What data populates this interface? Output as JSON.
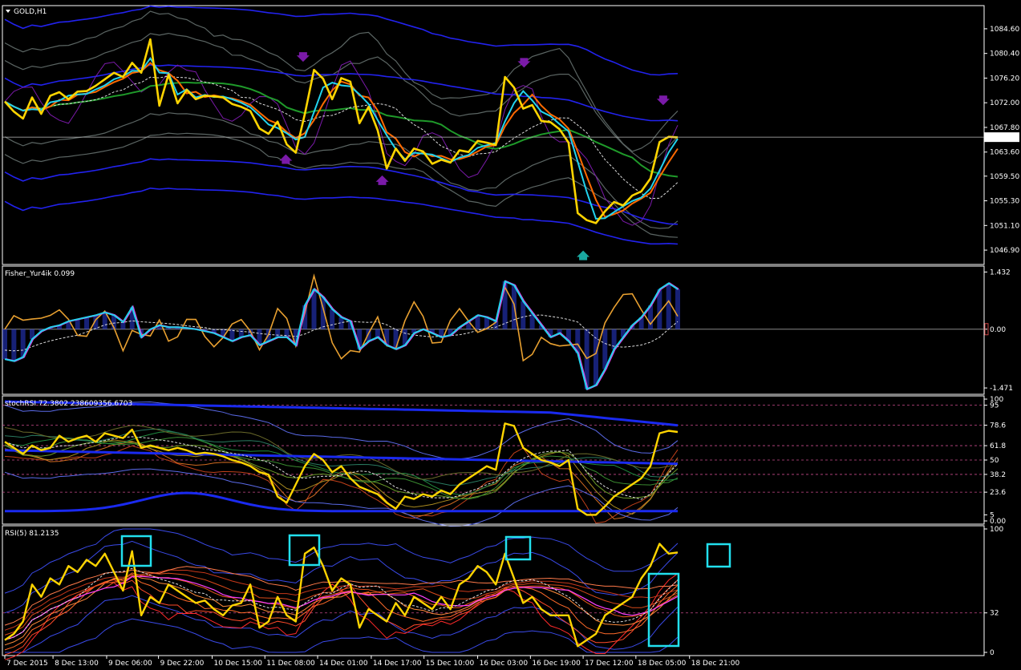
{
  "window": {
    "title": "GOLD,H1",
    "title_arrow_icon": "triangle-down-icon"
  },
  "colors": {
    "background": "#000000",
    "frame": "#ffffff",
    "price_line": "#ffd400",
    "cyan": "#22d3ee",
    "orange": "#ff6a00",
    "green": "#1f9a2a",
    "blue": "#2222ee",
    "grey": "#5b6563",
    "purple": "#7a1aa8",
    "magenta_dash": "#c84a8a",
    "highlight_box": "#22e0ee"
  },
  "chart_data": [
    {
      "name": "price",
      "type": "line",
      "title": "GOLD,H1",
      "ylim": [
        1045.0,
        1088.0
      ],
      "y_ticks": [
        "1084.60",
        "1080.40",
        "1076.20",
        "1072.00",
        "1067.80",
        "1063.60",
        "1059.50",
        "1055.30",
        "1051.10",
        "1046.90"
      ],
      "y_tick_values": [
        1084.6,
        1080.4,
        1076.2,
        1072.0,
        1067.8,
        1063.6,
        1059.5,
        1055.3,
        1051.1,
        1046.9
      ],
      "current_price_label": "1066.14",
      "current_price": 1066.14,
      "series": [
        {
          "values": [
            1072.2,
            1070.5,
            1069.3,
            1072.9,
            1070.1,
            1073.2,
            1073.8,
            1072.6,
            1073.9,
            1074.0,
            1074.9,
            1076.0,
            1077.1,
            1076.4,
            1078.8,
            1077.1,
            1082.8,
            1071.5,
            1076.8,
            1071.9,
            1074.2,
            1072.6,
            1073.2,
            1073.1,
            1072.9,
            1071.8,
            1071.3,
            1070.6,
            1067.6,
            1066.7,
            1068.8,
            1064.9,
            1063.5,
            1070.1,
            1077.6,
            1076.1,
            1072.6,
            1076.2,
            1075.6,
            1068.5,
            1071.3,
            1067.3,
            1060.8,
            1064.2,
            1062.1,
            1064.2,
            1063.7,
            1061.6,
            1062.3,
            1061.8,
            1063.9,
            1063.6,
            1065.5,
            1065.2,
            1064.8,
            1076.4,
            1074.6,
            1071.0,
            1071.6,
            1068.9,
            1068.7,
            1067.5,
            1065.2,
            1053.2,
            1052.0,
            1051.5,
            1053.5,
            1055.1,
            1054.5,
            1056.2,
            1056.9,
            1059.1,
            1065.3,
            1066.2,
            1066.1
          ]
        }
      ]
    },
    {
      "name": "fisher",
      "type": "line",
      "title": "Fisher_Yur4ik 0.099",
      "ylim": [
        -1.55,
        1.5
      ],
      "y_ticks": [
        "1.432",
        "0.00",
        "-1.471"
      ],
      "y_tick_values": [
        1.432,
        0.0,
        -1.471
      ],
      "series": [
        {
          "values": [
            -0.75,
            -0.8,
            -0.7,
            -0.25,
            -0.05,
            0.05,
            0.1,
            0.2,
            0.25,
            0.3,
            0.35,
            0.42,
            0.35,
            0.18,
            0.55,
            -0.2,
            0.0,
            0.1,
            0.05,
            0.05,
            0.03,
            0.0,
            -0.05,
            -0.1,
            -0.2,
            -0.3,
            -0.2,
            -0.15,
            -0.4,
            -0.3,
            -0.2,
            -0.2,
            -0.4,
            0.6,
            1.0,
            0.8,
            0.5,
            0.3,
            0.2,
            -0.5,
            -0.3,
            -0.2,
            -0.4,
            -0.5,
            -0.4,
            -0.1,
            0.0,
            -0.1,
            -0.2,
            -0.15,
            0.05,
            0.2,
            0.35,
            0.3,
            0.2,
            1.2,
            1.1,
            0.7,
            0.4,
            0.1,
            -0.2,
            -0.1,
            -0.3,
            -0.6,
            -1.5,
            -1.4,
            -1.0,
            -0.5,
            -0.2,
            0.1,
            0.3,
            0.6,
            1.0,
            1.15,
            1.0
          ]
        }
      ]
    },
    {
      "name": "stoch_rsi",
      "type": "line",
      "title": "stochRSI 72.3802 238609356.6703",
      "ylim": [
        0,
        100
      ],
      "y_ticks": [
        "100",
        "95",
        "78.6",
        "61.8",
        "50",
        "38.2",
        "23.6",
        "5",
        "0.00"
      ],
      "y_tick_values": [
        100,
        95,
        78.6,
        61.8,
        50,
        38.2,
        23.6,
        5,
        0
      ],
      "series": [
        {
          "values": [
            65,
            60,
            55,
            62,
            58,
            60,
            70,
            65,
            68,
            70,
            65,
            72,
            70,
            68,
            75,
            60,
            62,
            60,
            58,
            60,
            58,
            55,
            56,
            55,
            53,
            50,
            48,
            45,
            40,
            38,
            20,
            15,
            30,
            45,
            55,
            50,
            40,
            45,
            35,
            28,
            25,
            22,
            15,
            10,
            20,
            18,
            22,
            20,
            25,
            22,
            30,
            35,
            40,
            45,
            42,
            80,
            78,
            60,
            55,
            50,
            48,
            45,
            50,
            10,
            5,
            5,
            12,
            20,
            25,
            30,
            35,
            45,
            72,
            74,
            73
          ]
        }
      ]
    },
    {
      "name": "rsi",
      "type": "line",
      "title": "RSI(5) 81.2135",
      "ylim": [
        0,
        100
      ],
      "y_ticks": [
        "100",
        "32",
        "0"
      ],
      "y_tick_values": [
        100,
        32,
        0
      ],
      "series": [
        {
          "values": [
            10,
            15,
            25,
            55,
            45,
            60,
            55,
            70,
            65,
            75,
            70,
            80,
            65,
            50,
            82,
            30,
            45,
            40,
            55,
            50,
            45,
            40,
            42,
            35,
            30,
            38,
            40,
            55,
            20,
            25,
            45,
            30,
            25,
            80,
            85,
            70,
            50,
            60,
            55,
            20,
            35,
            30,
            25,
            40,
            30,
            45,
            40,
            35,
            45,
            35,
            55,
            60,
            70,
            65,
            55,
            80,
            60,
            40,
            45,
            35,
            30,
            30,
            30,
            5,
            10,
            15,
            30,
            35,
            40,
            45,
            60,
            70,
            88,
            80,
            81
          ]
        }
      ]
    }
  ],
  "time_axis": {
    "labels": [
      "7 Dec 2015",
      "8 Dec 13:00",
      "9 Dec 06:00",
      "9 Dec 22:00",
      "10 Dec 15:00",
      "11 Dec 08:00",
      "14 Dec 01:00",
      "14 Dec 17:00",
      "15 Dec 10:00",
      "16 Dec 03:00",
      "16 Dec 19:00",
      "17 Dec 12:00",
      "18 Dec 05:00",
      "18 Dec 21:00"
    ],
    "positions": [
      0,
      5.3,
      11.2,
      16.9,
      22.8,
      28.6,
      34.4,
      40.3,
      46.1,
      52.0,
      57.8,
      63.6,
      69.4,
      75.3
    ]
  },
  "annotations": {
    "price_arrows": [
      {
        "icon": "arrow-down-icon",
        "index": 32.8,
        "value": 1079.8,
        "color": "#7a1aa8"
      },
      {
        "icon": "arrow-up-icon",
        "index": 30.9,
        "value": 1062.4,
        "color": "#7a1aa8"
      },
      {
        "icon": "arrow-up-icon",
        "index": 41.5,
        "value": 1058.8,
        "color": "#7a1aa8"
      },
      {
        "icon": "arrow-down-icon",
        "index": 57.1,
        "value": 1078.8,
        "color": "#7a1aa8"
      },
      {
        "icon": "arrow-down-icon",
        "index": 72.4,
        "value": 1072.4,
        "color": "#7a1aa8"
      },
      {
        "icon": "arrow-up-icon",
        "index": 63.6,
        "value": 1046.0,
        "color": "#1aa8a0"
      }
    ]
  }
}
